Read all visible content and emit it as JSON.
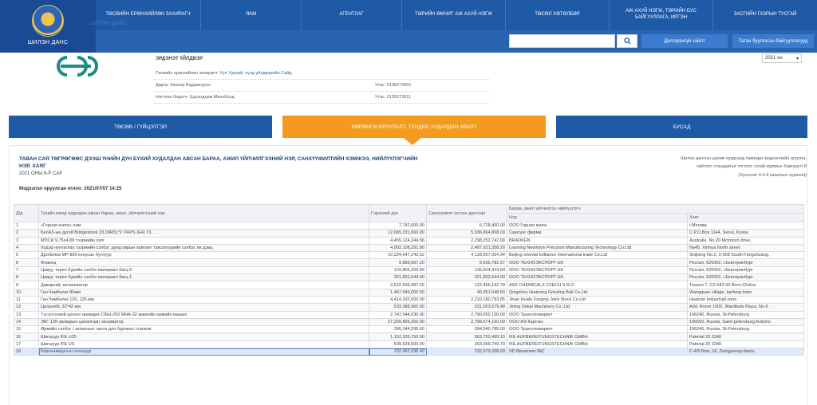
{
  "site": {
    "logo_text": "ШИЛЭН ДАНС",
    "ghost_text": "ШИЛЭН ДАНС"
  },
  "nav": {
    "items": [
      "ТӨСВИЙН ЕРӨНХИЙЛӨН ЗАХИРАГЧ",
      "ЯАМ",
      "АГЕНТЛАГ",
      "ТӨРИЙН ӨМЧИТ АЖ АХУЙ НЭГЖ",
      "ТӨСӨЛ ХӨТӨЛБӨР",
      "АЖ АХУЙ НЭГЖ, ТӨРИЙН БУС БАЙГУУЛЛАГА, ИРГЭН",
      "ЗАСГИЙН ГАЗРЫН ТУСГАЙ"
    ],
    "search_placeholder": "",
    "advanced_search": "Дэлгэрэнгүй хайлт",
    "complaint_button": "Татан буулгасан байгууллагууд"
  },
  "org": {
    "name": "ЭРДЭНЭТ ҮЙЛДВЭР",
    "manager_label": "Төсвийн ерөнхийлөн захирагч:",
    "manager_value": "Уул Уурхай, хүнд үйлдвэрийн Сайд",
    "director": "Дарга: Хөхоор Бадамсүрэн",
    "accountant": "Нягтлан бодогч: Цэрэндорж Мөнхболд",
    "phone1": "Утас: 0135273501",
    "phone2": "Утас: 0135273511",
    "year": "2021 он"
  },
  "tabs": [
    {
      "label": "ТӨСӨВ / ГҮЙЦЭТГЭЛ",
      "color": "#1f5aa6"
    },
    {
      "label": "ХӨРӨНГӨ ОРУУЛАЛТ, ТЕНДЕР, ХУДАЛДАН АВАЛТ",
      "color": "#f49a1f"
    },
    {
      "label": "БУСАД",
      "color": "#1f5aa6"
    }
  ],
  "report": {
    "title": "ТАВАН САЯ ТӨГРӨГӨӨС ДЭЭШ ҮНИЙН ДҮН БҮХИЙ ХУДАЛДАН АВСАН БАРАА, АЖИЛ ҮЙЛЧИЛГЭЭНИЙ НЭР, САНХҮҮЖИЛТИЙН ХЭМЖЭЭ, НИЙЛҮҮЛЭГЧИЙН НЭР, ХАЯГ",
    "subtitle": "2021 ОНЫ 6-Р САР",
    "posted": "Мэдээлэл оруулсан огноо: 2021/07/07 14:25",
    "note1": "Шилэн дансны цахим хуудсанд тавигдах мэдээллийн агуулга,",
    "note2": "нийтлэг стандартыг тогтоох тухай журмын Хавсралт 8",
    "note3": "(Хүснэгт 6.4.4 заагтын хүрээнд)"
  },
  "table": {
    "headers": {
      "no": "Д/д",
      "item": "Тухайн жилд худалдан авсан бараа, ажил, үйлчилгээний нэр",
      "contract": "Гэрээний дүн",
      "paid": "Санхүүжилт /өссөн дүнгээр/",
      "supplier_group": "Бараа, ажил үйлчилгээ нийлүүлэгч",
      "supplier_name": "Нэр",
      "supplier_address": "Хаяг"
    },
    "rows": [
      {
        "no": "1",
        "item": "«Горная книга» ном",
        "contract": "7,742,000.00",
        "paid": "6,728,400.00",
        "name": "ООО Горная книга",
        "address": "г.Москва"
      },
      {
        "no": "2",
        "item": "БелАЗ-ын дугуй Bridgestone 33.00R51*2 VRPS (E4) T/L",
        "contract": "12,689,331,060.00",
        "paid": "5,936,864,808.00",
        "name": "Самсунг фирма",
        "address": "C.P.O.Box 1144, Seoul, Korea"
      },
      {
        "no": "3",
        "item": "МПСИ 9,75х4,88 тээрмийн хуяг",
        "contract": "4,455,124,244.56",
        "paid": "2,298,252,747.68",
        "name": "BRADKEN",
        "address": "Australia. No.20 Mcintosh drive,"
      },
      {
        "no": "4",
        "item": "Хүдэр нунтаглах тээрмийн сэлбэг, дунд оврын хавтант тэжээгүүрийн сэлбэг, их дэвц",
        "contract": "4,902,108,291.80",
        "paid": "2,487,921,358.20",
        "name": "Liaoning Newfoton Precision Manufacturing Technology Co.Ltd",
        "address": "No45, Xinhua North street"
      },
      {
        "no": "5",
        "item": "Дробилка МР-800 конусан бутлуур",
        "contract": "10,224,647,243.52",
        "paid": "4,128,657,054.34",
        "name": "Beijing oriental brilliance International trade Co.Ltd",
        "address": "Shijixing No.2, 3-908 South Fangzhuang,"
      },
      {
        "no": "6",
        "item": "Фланец",
        "contract": "9,899,997.20",
        "paid": "9,935,781.57",
        "name": "ООО ТЕХНОЭКСПОРТ-ЕК",
        "address": "Россия, 620062, г.Екатеринбург"
      },
      {
        "no": "7",
        "item": "Цавуу, терел бүрийн сэлбэг материал багц-6",
        "contract": "129,805,309.80",
        "paid": "135,504,424.84",
        "name": "ООО ТЕХНОЭКСПОРТ-ЕК",
        "address": "Россия, 620062, г.Екатеринбург"
      },
      {
        "no": "8",
        "item": "Цавуу, терел бүрийн сэлбэг материал багц-1",
        "contract": "321,802,644.00",
        "paid": "321,802,644.00",
        "name": "ООО ТЕХНОЭКСПОРТ-ЕК",
        "address": "Россия, 620062, г.Екатеринбург"
      },
      {
        "no": "9",
        "item": "Давирхай, катализатор",
        "contract": "3,622,509,487.20",
        "paid": "122,466,192.78",
        "name": "ASK CHEMICALS CZECH S.R.O",
        "address": "Tovarni 7, CZ-643 00 Brno-Chrlice"
      },
      {
        "no": "10",
        "item": "Ган бөмбөлөг 80мм",
        "contract": "1,467,949,600.00",
        "paid": "40,351,648.60",
        "name": "Qingzhou Huahong Grinding Ball Co.Ltd",
        "address": "Wangquan village, tanfang town"
      },
      {
        "no": "11",
        "item": "Ган бөмбөлөг 120, 125 мм",
        "contract": "4,414,332,000.00",
        "paid": "2,210,180,793.85",
        "name": "Jinan Huafu Forging Joint-Stock Co.Ltd",
        "address": "Huaimin Indusrtrall zone"
      },
      {
        "no": "12",
        "item": "Цильпебс 32*42 мм",
        "contract": "533,388,960.00",
        "paid": "531,653,579.48",
        "name": "Jining Dekai Machinery Co.,Ltd",
        "address": "Add: Room 1005, Wanlifude Plaza, No.6"
      },
      {
        "no": "13",
        "item": "Тэсэлгээний цооног өрөмдөх СБШ-250 МНА-32 маркийн өрмийн машин",
        "contract": "2,747,044,630.00",
        "paid": "2,790,052,100.00",
        "name": "ООО Трансгехмаркет",
        "address": "196240, Russia, St-Petersburg"
      },
      {
        "no": "14",
        "item": "ЭКГ-12К загварын цахилгаан экскаватор",
        "contract": "27,209,899,200.00",
        "paid": "2,758,674,160.00",
        "name": "ООО ИЗ-Картэкс",
        "address": "196650, Russia, Saint-petersburg,Kolpino"
      },
      {
        "no": "15",
        "item": "Өрмийн сэлбэг / запасные части для буровых станков",
        "contract": "395,344,095.00",
        "paid": "394,540,795.00",
        "name": "ООО Трансгехмаркет",
        "address": "196240, Russia, St-Petersburg"
      },
      {
        "no": "16",
        "item": "Шигшүүр IFE U25",
        "contract": "1,152,205,750.00",
        "paid": "563,700,499.15",
        "name": "IFE AUFBEREITUNGSTECHNIK GMBH",
        "address": "Paterial 20 3340"
      },
      {
        "no": "17",
        "item": "Шигшүүр IFE US",
        "contract": "539,528,500.00",
        "paid": "263,956,749.70",
        "name": "IFE AUFBEREITUNGSTECHNIK GMBH",
        "address": "Paterial 20 3340"
      },
      {
        "no": "18",
        "item": "Коронавирусын оношуур",
        "contract": "232,962,038.40",
        "paid": "232,979,208.00",
        "name": "SD Biosenser INC",
        "address": "C-4/5 floor, 16, Deogyeong-daero"
      }
    ]
  }
}
